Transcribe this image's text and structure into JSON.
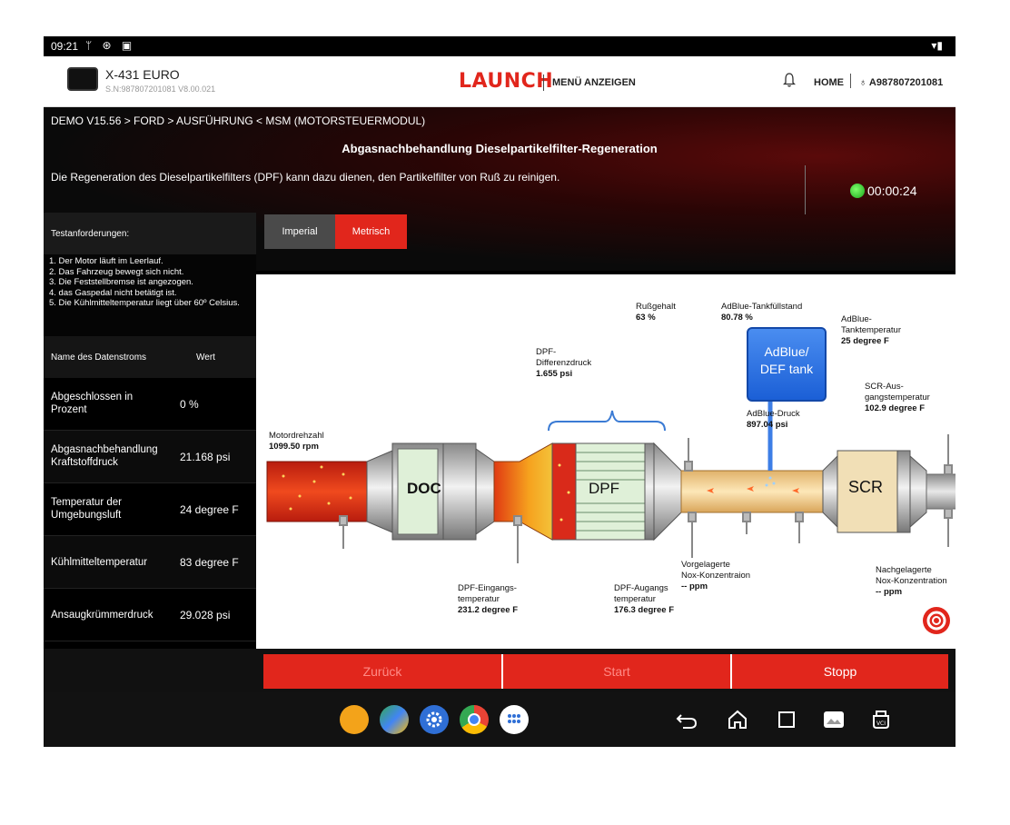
{
  "status_bar": {
    "time": "09:21"
  },
  "header": {
    "device_name": "X-431 EURO",
    "device_serial": "S.N:987807201081  V8.00.021",
    "logo": "LAUNCH",
    "menu_label": "MENÜ ANZEIGEN",
    "home_label": "HOME",
    "user_id": "A987807201081"
  },
  "info": {
    "breadcrumb": "DEMO V15.56 > FORD > AUSFÜHRUNG < MSM  (MOTORSTEUERMODUL)",
    "title": "Abgasnachbehandlung Dieselpartikelfilter-Regeneration",
    "description": "Die Regeneration des Dieselpartikelfilters (DPF) kann dazu dienen, den Partikelfilter von Ruß zu reinigen.",
    "timer": "00:00:24"
  },
  "requirements": {
    "header": "Testanforderungen:",
    "items": [
      "1. Der Motor läuft im Leerlauf.",
      "2. Das Fahrzeug bewegt sich nicht.",
      "3. Die Feststellbremse ist angezogen.",
      "4. das Gaspedal nicht betätigt ist.",
      "5. Die Kühlmitteltemperatur liegt über 60º Celsius."
    ]
  },
  "datastream": {
    "col_name": "Name des Datenstroms",
    "col_value": "Wert",
    "rows": [
      {
        "name": "Abgeschlossen in Prozent",
        "value": "0 %"
      },
      {
        "name": "Abgasnachbehandlung Kraftstoffdruck",
        "value": "21.168 psi"
      },
      {
        "name": "Temperatur der Umgebungsluft",
        "value": "24 degree F"
      },
      {
        "name": "Kühlmitteltemperatur",
        "value": "83 degree F"
      },
      {
        "name": "Ansaugkrümmerdruck",
        "value": "29.028 psi"
      }
    ]
  },
  "units": {
    "imperial": "Imperial",
    "metric": "Metrisch",
    "selected": "metric"
  },
  "diagram": {
    "motor_label": "Motordrehzahl",
    "motor_value": "1099.50 rpm",
    "doc_label": "DOC",
    "dpf_label": "DPF",
    "scr_label": "SCR",
    "dpf_diff_label1": "DPF-",
    "dpf_diff_label2": "Differenzdruck",
    "dpf_diff_value": "1.655 psi",
    "soot_label": "Rußgehalt",
    "soot_value": "63 %",
    "adblue_level_label": "AdBlue-Tankfüllstand",
    "adblue_level_value": "80.78 %",
    "adblue_temp_label1": "AdBlue-",
    "adblue_temp_label2": "Tanktemperatur",
    "adblue_temp_value": "25 degree F",
    "tank_line1": "AdBlue/",
    "tank_line2": "DEF tank",
    "adblue_press_label": "AdBlue-Druck",
    "adblue_press_value": "897.04 psi",
    "scr_out_label1": "SCR-Aus-",
    "scr_out_label2": "gangstemperatur",
    "scr_out_value": "102.9 degree F",
    "dpf_in_label1": "DPF-Eingangs-",
    "dpf_in_label2": "temperatur",
    "dpf_in_value": "231.2 degree F",
    "dpf_out_label1": "DPF-Augangs",
    "dpf_out_label2": "temperatur",
    "dpf_out_value": "176.3 degree F",
    "nox_up_label1": "Vorgelagerte",
    "nox_up_label2": "Nox-Konzentraion",
    "nox_up_value": "-- ppm",
    "nox_down_label1": "Nachgelagerte",
    "nox_down_label2": "Nox-Konzentration",
    "nox_down_value": "-- ppm"
  },
  "actions": {
    "back": "Zurück",
    "start": "Start",
    "stop": "Stopp"
  },
  "colors": {
    "accent": "#e1261c",
    "status_ok": "#2ecc2e",
    "tank": "#1b5fd6"
  }
}
